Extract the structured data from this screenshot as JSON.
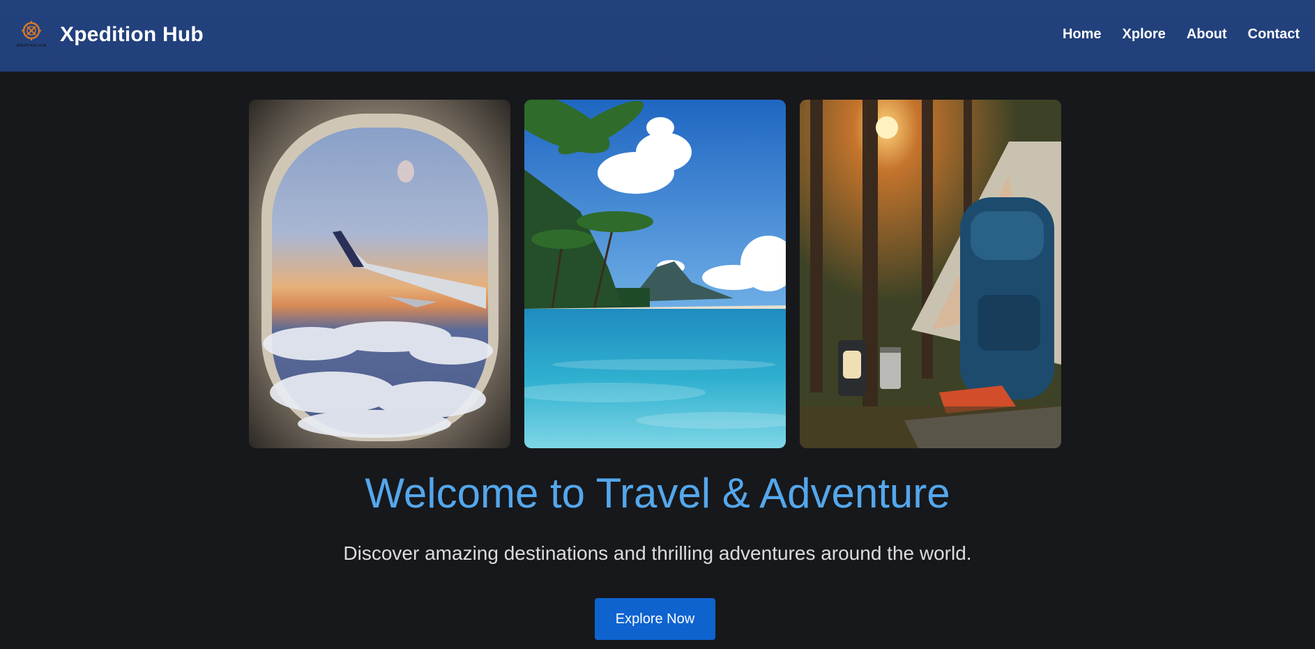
{
  "header": {
    "brand": "Xpedition Hub",
    "logo_text": "XPEDITION HUB",
    "nav": [
      {
        "label": "Home"
      },
      {
        "label": "Xplore"
      },
      {
        "label": "About"
      },
      {
        "label": "Contact"
      }
    ]
  },
  "gallery": [
    {
      "name": "airplane-window-photo"
    },
    {
      "name": "tropical-beach-photo"
    },
    {
      "name": "forest-camping-photo"
    }
  ],
  "hero": {
    "title": "Welcome to Travel & Adventure",
    "subtitle": "Discover amazing destinations and thrilling adventures around the world.",
    "cta_label": "Explore Now"
  },
  "colors": {
    "header_bg": "#23427d",
    "page_bg": "#17181b",
    "title_color": "#54a7ec",
    "button_bg": "#0e63cf"
  }
}
